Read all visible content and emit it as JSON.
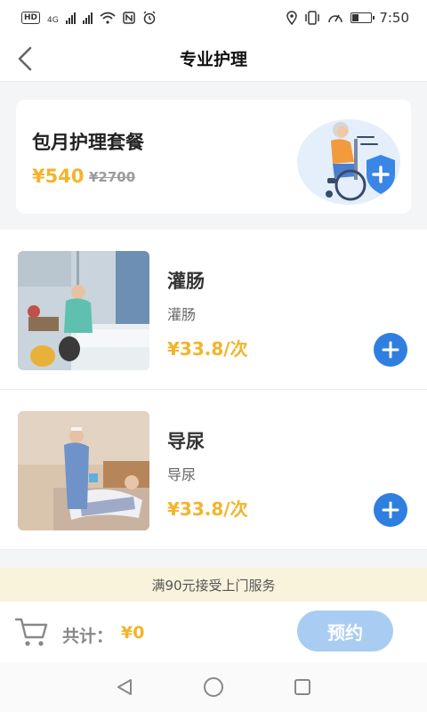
{
  "status_bar": {
    "left_badges": [
      "HD",
      "4G"
    ],
    "time": "7:50",
    "battery_level": 0.3
  },
  "header": {
    "title": "专业护理",
    "back_icon": "chevron-left-icon"
  },
  "package": {
    "title": "包月护理套餐",
    "price": "¥540",
    "original_price": "¥2700",
    "illustration_icon": "wheelchair-shield-icon"
  },
  "services": [
    {
      "name": "灌肠",
      "desc": "灌肠",
      "price": "¥33.8/次"
    },
    {
      "name": "导尿",
      "desc": "导尿",
      "price": "¥33.8/次"
    }
  ],
  "notice": "满90元接受上门服务",
  "cart": {
    "total_label": "共计：",
    "total_amount": "¥0",
    "book_label": "预约"
  },
  "colors": {
    "price": "#f3b42a",
    "accent_blue": "#2f7fe0",
    "book_button": "#a9cdf2",
    "notice_bg": "#faf3dc"
  }
}
